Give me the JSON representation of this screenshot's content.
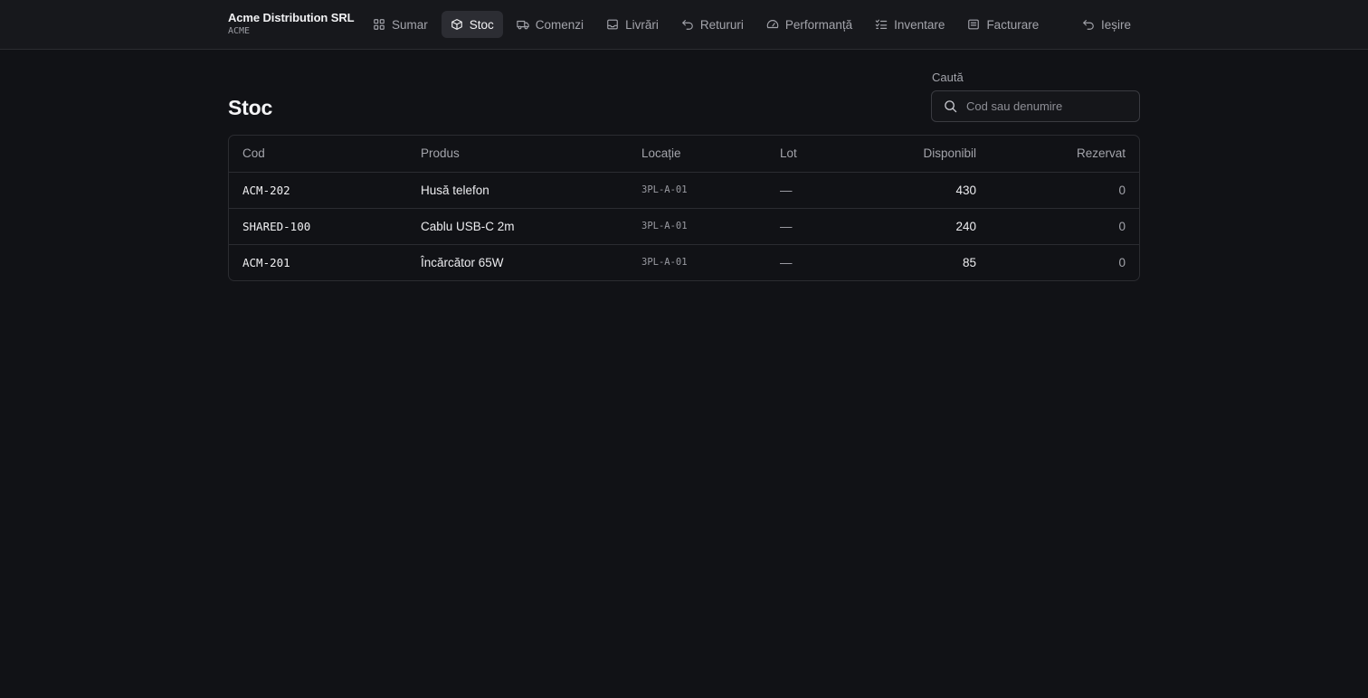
{
  "brand": {
    "name": "Acme Distribution SRL",
    "code": "ACME"
  },
  "nav": {
    "items": [
      {
        "label": "Sumar",
        "icon": "grid-icon",
        "active": false
      },
      {
        "label": "Stoc",
        "icon": "box-icon",
        "active": true
      },
      {
        "label": "Comenzi",
        "icon": "truck-icon",
        "active": false
      },
      {
        "label": "Livrări",
        "icon": "inbox-icon",
        "active": false
      },
      {
        "label": "Retururi",
        "icon": "undo-icon",
        "active": false
      },
      {
        "label": "Performanță",
        "icon": "gauge-icon",
        "active": false
      },
      {
        "label": "Inventare",
        "icon": "checklist-icon",
        "active": false
      },
      {
        "label": "Facturare",
        "icon": "invoice-icon",
        "active": false
      }
    ],
    "logout": {
      "label": "Ieșire",
      "icon": "logout-icon"
    }
  },
  "page": {
    "title": "Stoc"
  },
  "search": {
    "label": "Caută",
    "placeholder": "Cod sau denumire",
    "value": ""
  },
  "table": {
    "columns": [
      "Cod",
      "Produs",
      "Locație",
      "Lot",
      "Disponibil",
      "Rezervat"
    ],
    "rows": [
      {
        "cod": "ACM-202",
        "produs": "Husă telefon",
        "locatie": "3PL-A-01",
        "lot": "—",
        "disponibil": "430",
        "rezervat": "0"
      },
      {
        "cod": "SHARED-100",
        "produs": "Cablu USB-C 2m",
        "locatie": "3PL-A-01",
        "lot": "—",
        "disponibil": "240",
        "rezervat": "0"
      },
      {
        "cod": "ACM-201",
        "produs": "Încărcător 65W",
        "locatie": "3PL-A-01",
        "lot": "—",
        "disponibil": "85",
        "rezervat": "0"
      }
    ]
  },
  "colors": {
    "background": "#111216",
    "topbar": "#17181c",
    "active_tab": "#2c2d33",
    "border": "#2b2c31"
  }
}
